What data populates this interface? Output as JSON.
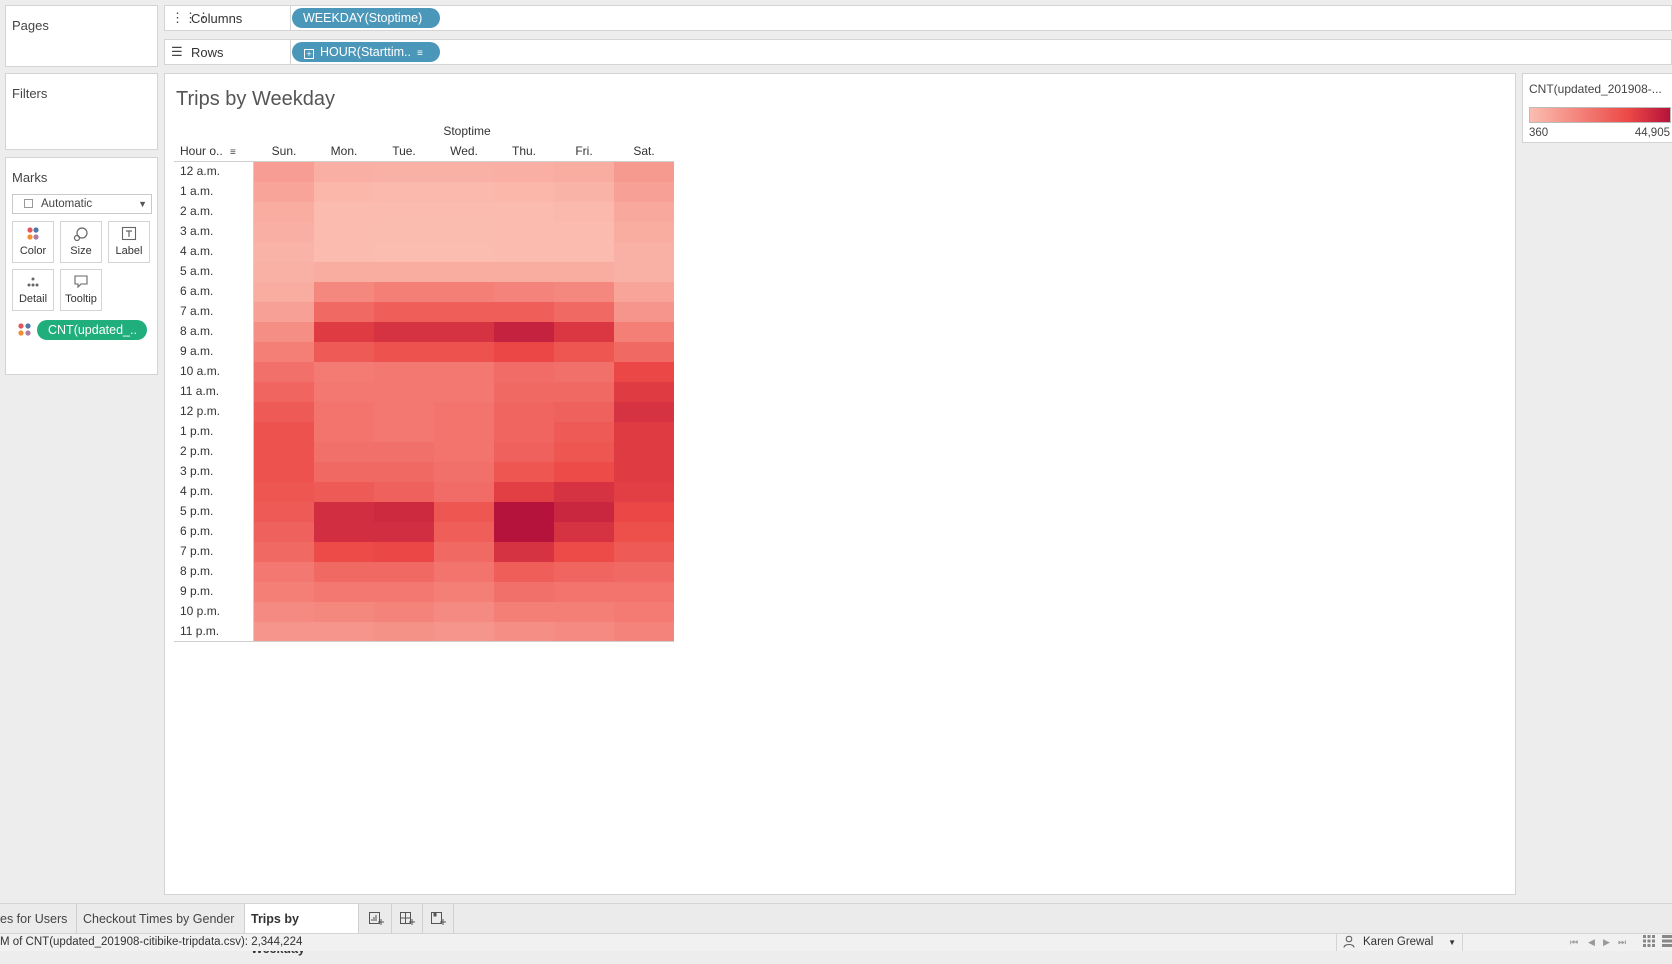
{
  "cards": {
    "pages_title": "Pages",
    "filters_title": "Filters",
    "marks_title": "Marks",
    "mark_type": "Automatic",
    "buttons": {
      "color": "Color",
      "size": "Size",
      "label": "Label",
      "detail": "Detail",
      "tooltip": "Tooltip"
    },
    "color_pill": "CNT(updated_.."
  },
  "shelves": {
    "columns_label": "Columns",
    "columns_pill": "WEEKDAY(Stoptime)",
    "rows_label": "Rows",
    "rows_pill": "HOUR(Starttim.."
  },
  "sheet": {
    "title": "Trips by Weekday",
    "column_field": "Stoptime",
    "row_field": "Hour o.."
  },
  "legend": {
    "title": "CNT(updated_201908-...",
    "min_label": "360",
    "max_label": "44,905",
    "color_low": "#fbbdb0",
    "color_high": "#b5123c"
  },
  "chart_data": {
    "type": "heatmap",
    "title": "Trips by Weekday",
    "x_label": "Stoptime",
    "y_label": "Hour o..",
    "columns": [
      "Sun.",
      "Mon.",
      "Tue.",
      "Wed.",
      "Thu.",
      "Fri.",
      "Sat."
    ],
    "rows": [
      "12 a.m.",
      "1 a.m.",
      "2 a.m.",
      "3 a.m.",
      "4 a.m.",
      "5 a.m.",
      "6 a.m.",
      "7 a.m.",
      "8 a.m.",
      "9 a.m.",
      "10 a.m.",
      "11 a.m.",
      "12 p.m.",
      "1 p.m.",
      "2 p.m.",
      "3 p.m.",
      "4 p.m.",
      "5 p.m.",
      "6 p.m.",
      "7 p.m.",
      "8 p.m.",
      "9 p.m.",
      "10 p.m.",
      "11 p.m."
    ],
    "color_range": [
      360,
      44905
    ],
    "values": [
      [
        9000,
        4000,
        3500,
        3500,
        4000,
        5000,
        10000
      ],
      [
        7000,
        2000,
        1500,
        1500,
        2000,
        3000,
        8000
      ],
      [
        5000,
        1000,
        800,
        800,
        1000,
        1500,
        6000
      ],
      [
        4000,
        700,
        500,
        500,
        700,
        1000,
        5000
      ],
      [
        3000,
        600,
        400,
        360,
        600,
        800,
        3500
      ],
      [
        3500,
        5000,
        5000,
        5000,
        5000,
        5000,
        3500
      ],
      [
        5000,
        15000,
        17000,
        17000,
        16000,
        15000,
        7000
      ],
      [
        8000,
        23000,
        26000,
        26000,
        26000,
        23000,
        11000
      ],
      [
        13000,
        35000,
        37000,
        37000,
        41000,
        36000,
        17000
      ],
      [
        17000,
        27000,
        29000,
        29000,
        32000,
        28000,
        23000
      ],
      [
        21000,
        18000,
        19000,
        19000,
        22000,
        21000,
        32000
      ],
      [
        24000,
        19000,
        19000,
        19000,
        23000,
        23000,
        35000
      ],
      [
        27000,
        20000,
        19000,
        20000,
        24000,
        25000,
        37000
      ],
      [
        29000,
        20000,
        19000,
        20000,
        24000,
        27000,
        35000
      ],
      [
        29000,
        21000,
        21000,
        20000,
        25000,
        28000,
        35000
      ],
      [
        29000,
        23000,
        23000,
        21000,
        28000,
        31000,
        35000
      ],
      [
        28000,
        27000,
        25000,
        22000,
        34000,
        37000,
        34000
      ],
      [
        27000,
        38000,
        39000,
        28000,
        44905,
        40000,
        32000
      ],
      [
        25000,
        38000,
        38000,
        26000,
        44905,
        37000,
        30000
      ],
      [
        23000,
        31000,
        32000,
        23000,
        37000,
        31000,
        27000
      ],
      [
        19000,
        23000,
        23000,
        20000,
        26000,
        24000,
        23000
      ],
      [
        17000,
        19000,
        19000,
        17000,
        21000,
        20000,
        20000
      ],
      [
        14000,
        15000,
        16000,
        14000,
        17000,
        17000,
        18000
      ],
      [
        11000,
        11000,
        12000,
        11000,
        13000,
        14000,
        16000
      ]
    ]
  },
  "tabs": {
    "tab1": "es for Users",
    "tab2": "Checkout Times by Gender",
    "tab3": "Trips by Weekday"
  },
  "status": {
    "summary": "M of CNT(updated_201908-citibike-tripdata.csv): 2,344,224",
    "user": "Karen Grewal"
  }
}
